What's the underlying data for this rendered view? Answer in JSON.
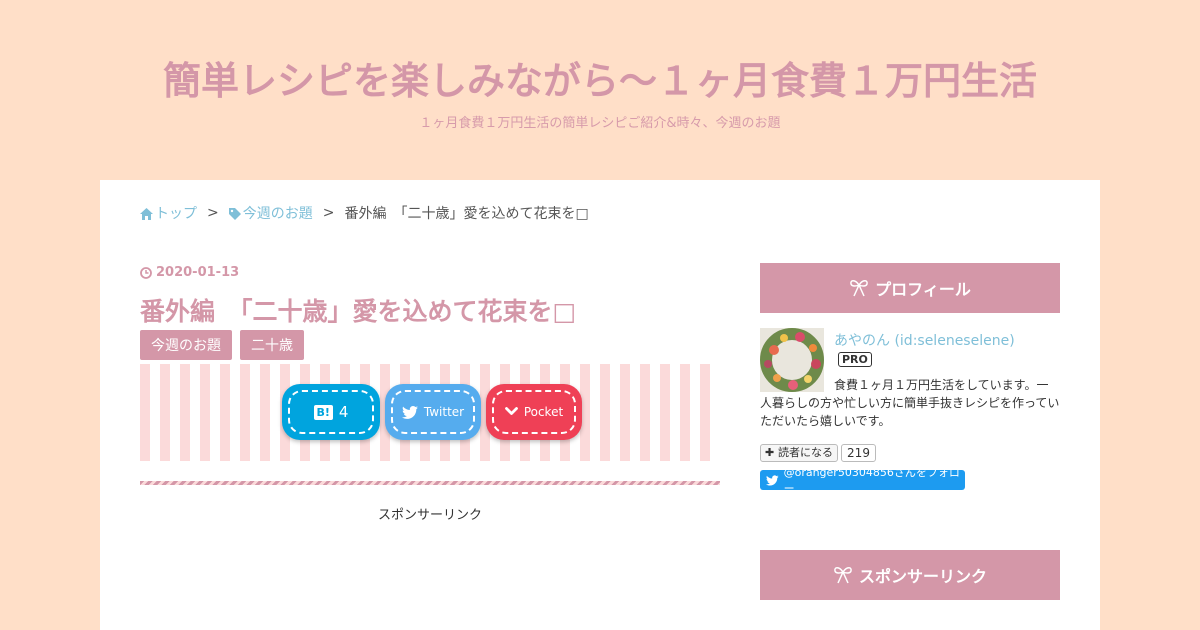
{
  "site": {
    "title": "簡単レシピを楽しみながら〜１ヶ月食費１万円生活",
    "description": "１ヶ月食費１万円生活の簡単レシピご紹介&時々、今週のお題"
  },
  "breadcrumb": {
    "home_label": "トップ",
    "separator": ">",
    "category_label": "今週のお題",
    "current": "番外編　「二十歳」愛を込めて花束を□"
  },
  "entry": {
    "date": "2020-01-13",
    "title": "番外編　「二十歳」愛を込めて花束を□",
    "categories": [
      "今週のお題",
      "二十歳"
    ]
  },
  "share": {
    "hatebu_count": "4",
    "twitter_label": "Twitter",
    "pocket_label": "Pocket"
  },
  "sponsor_main": "スポンサーリンク",
  "sidebar": {
    "profile_heading": "プロフィール",
    "profile_name": "あやのん (id:seleneselene)",
    "pro_badge": "PRO",
    "profile_text": "食費１ヶ月１万円生活をしています。一人暮らしの方や忙しい方に簡単手抜きレシピを作っていただいたら嬉しいです。",
    "reader_button": "読者になる",
    "reader_count": "219",
    "follow_label": "@oranger50304856さんをフォロー",
    "sponsor_heading": "スポンサーリンク"
  },
  "colors": {
    "background": "#ffdfc8",
    "accent": "#d497a8",
    "link": "#7fbfd8",
    "hatebu": "#00a4de",
    "twitter": "#55acee",
    "pocket": "#ef4056"
  },
  "icons": [
    "home-icon",
    "tag-icon",
    "clock-icon",
    "hatebu-icon",
    "twitter-icon",
    "pocket-icon",
    "ribbon-icon",
    "plus-icon"
  ]
}
